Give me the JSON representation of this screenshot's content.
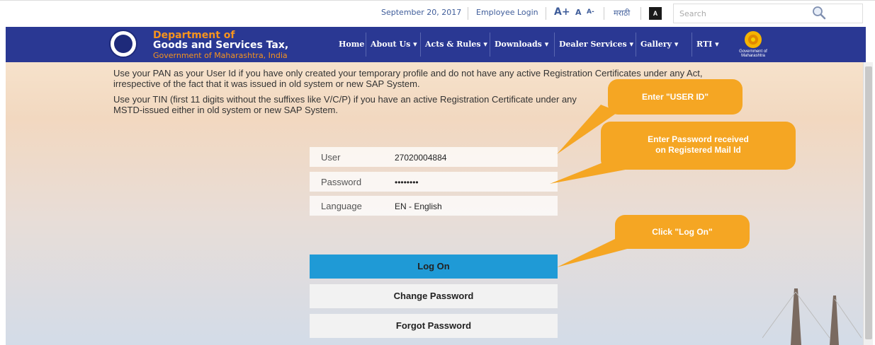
{
  "topbar": {
    "date": "September 20, 2017",
    "employee_login": "Employee Login",
    "font_large": "A+",
    "font_normal": "A",
    "font_small": "A-",
    "marathi": "मराठी",
    "contrast": "A",
    "search_placeholder": "Search"
  },
  "brand": {
    "line1": "Department of",
    "line2": "Goods and Services Tax,",
    "line3": "Government of Maharashtra, India",
    "gov_logo_text": "Government of Maharashtra"
  },
  "nav": [
    {
      "label": "Home"
    },
    {
      "label": "About Us ▾"
    },
    {
      "label": "Acts & Rules ▾"
    },
    {
      "label": "Downloads ▾"
    },
    {
      "label": "Dealer Services ▾"
    },
    {
      "label": "Gallery ▾"
    },
    {
      "label": "RTI ▾"
    }
  ],
  "info": {
    "para1_line1": "Use your PAN as your User Id if you have only created your temporary profile and do not have any active Registration Certificates under any Act,",
    "para1_line2": "irrespective of the fact that it was issued in old system or new SAP System.",
    "para2_line1": "Use your TIN (first 11 digits without the suffixes like V/C/P) if you have an active Registration Certificate under any",
    "para2_line2": "MSTD-issued either in old system or new SAP System."
  },
  "form": {
    "user_label": "User",
    "user_value": "27020004884",
    "password_label": "Password",
    "password_value": "••••••••",
    "language_label": "Language",
    "language_value": "EN - English"
  },
  "buttons": {
    "logon": "Log On",
    "change_password": "Change Password",
    "forgot_password": "Forgot Password"
  },
  "callouts": {
    "user_id": "Enter \"USER ID\"",
    "password_line1": "Enter Password received",
    "password_line2": "on Registered Mail Id",
    "logon": "Click \"Log On\""
  },
  "colors": {
    "nav_bg": "#2a3893",
    "brand_orange": "#f7941d",
    "logon_blue": "#1f9ad6",
    "callout_orange": "#f5a623"
  }
}
